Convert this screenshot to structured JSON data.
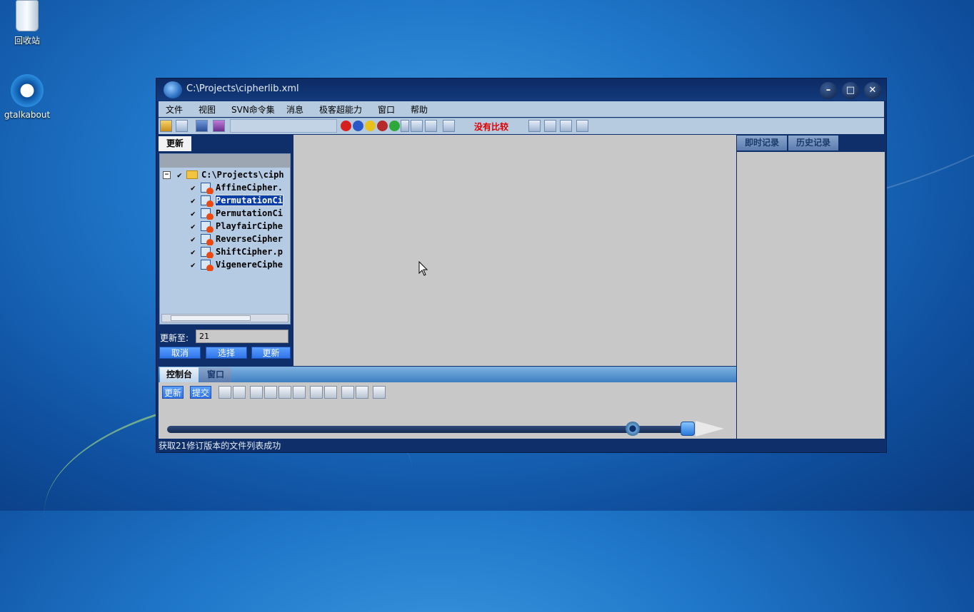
{
  "desktop": {
    "icons": [
      {
        "label": "回收站",
        "icon": "recycle-bin-icon"
      },
      {
        "label": "gtalkabout",
        "icon": "gtalkabout-icon"
      }
    ]
  },
  "window": {
    "title": "C:\\Projects\\cipherlib.xml",
    "controls": [
      "minimize",
      "maximize",
      "close"
    ]
  },
  "menu": [
    "文件",
    "视图",
    "SVN命令集",
    "消息",
    "极客超能力",
    "窗口",
    "帮助"
  ],
  "toolbar": {
    "status_text": "没有比较"
  },
  "left_panel": {
    "tab": "更新",
    "tree": {
      "root": "C:\\Projects\\ciph",
      "files": [
        {
          "name": "AffineCipher.",
          "selected": false
        },
        {
          "name": "PermutationCi",
          "selected": true
        },
        {
          "name": "PermutationCi",
          "selected": false
        },
        {
          "name": "PlayfairCiphe",
          "selected": false
        },
        {
          "name": "ReverseCipher",
          "selected": false
        },
        {
          "name": "ShiftCipher.p",
          "selected": false
        },
        {
          "name": "VigenereCiphe",
          "selected": false
        }
      ]
    },
    "update_to_label": "更新至:",
    "update_to_value": "21",
    "buttons": {
      "cancel": "取消",
      "select": "选择",
      "update": "更新"
    }
  },
  "right_panel": {
    "tabs": [
      "即时记录",
      "历史记录"
    ]
  },
  "console": {
    "tabs": [
      "控制台",
      "窗口"
    ],
    "buttons": {
      "update": "更新",
      "commit": "提交"
    }
  },
  "status_bar": {
    "text": "获取21修订版本的文件列表成功"
  }
}
